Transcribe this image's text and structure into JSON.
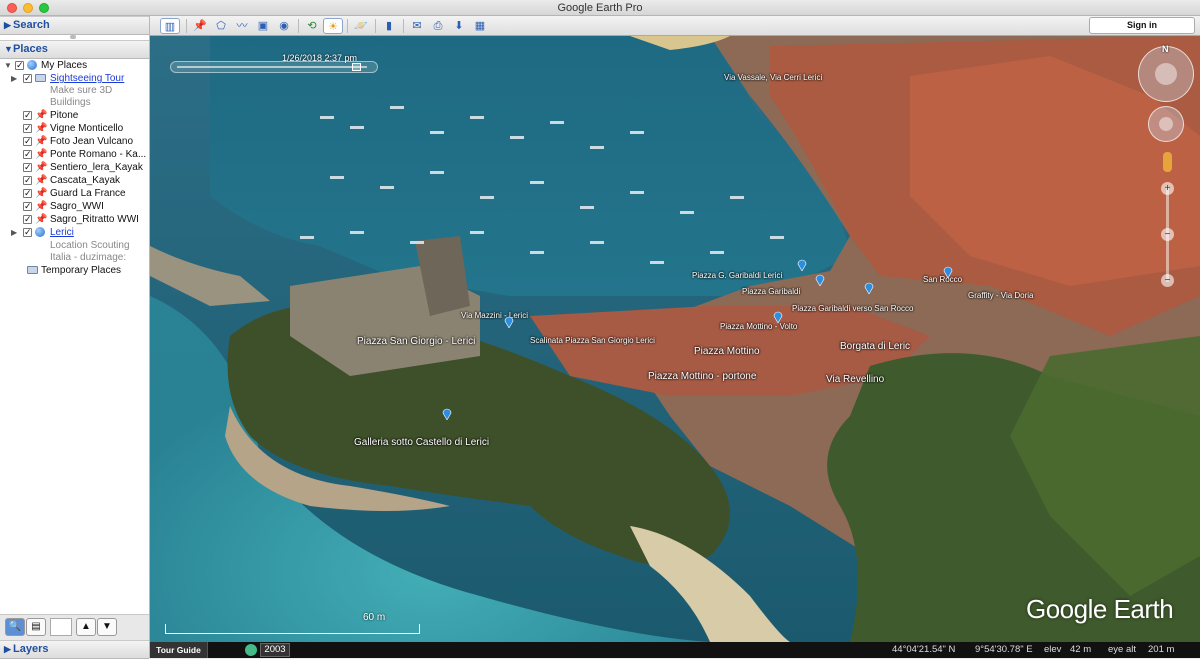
{
  "window": {
    "title": "Google Earth Pro"
  },
  "sidebar": {
    "search_label": "Search",
    "places_label": "Places",
    "layers_label": "Layers",
    "tree": [
      {
        "label": "My Places",
        "kind": "globe",
        "checked": true,
        "link": false
      },
      {
        "label": "Sightseeing Tour",
        "kind": "folder",
        "checked": true,
        "link": true
      },
      {
        "label": "Make sure 3D",
        "kind": "desc"
      },
      {
        "label": "Buildings",
        "kind": "desc"
      },
      {
        "label": "Pitone",
        "kind": "pin",
        "checked": true
      },
      {
        "label": "Vigne Monticello",
        "kind": "pin",
        "checked": true
      },
      {
        "label": "Foto Jean Vulcano",
        "kind": "pin",
        "checked": true
      },
      {
        "label": "Ponte Romano - Ka...",
        "kind": "pin",
        "checked": true
      },
      {
        "label": "Sentiero_lera_Kayak",
        "kind": "pin",
        "checked": true
      },
      {
        "label": "Cascata_Kayak",
        "kind": "pin",
        "checked": true
      },
      {
        "label": "Guard La France",
        "kind": "pin",
        "checked": true
      },
      {
        "label": "Sagro_WWI",
        "kind": "pin",
        "checked": true
      },
      {
        "label": "Sagro_Ritratto WWI",
        "kind": "pin",
        "checked": true
      },
      {
        "label": "Lerici",
        "kind": "globe",
        "checked": true,
        "link": true
      },
      {
        "label": "Location Scouting",
        "kind": "desc"
      },
      {
        "label": "Italia - duzimage:",
        "kind": "desc"
      },
      {
        "label": "Temporary Places",
        "kind": "folder-plain"
      }
    ]
  },
  "toolbar": {
    "signin_label": "Sign in"
  },
  "map": {
    "timestamp": "1/26/2018   2:37 pm",
    "scale_label": "60 m",
    "logo": "Google Earth",
    "nav_north": "N",
    "labels": {
      "via_mazzini": "Via Mazzini - Lerici",
      "piazza_san_giorgio": "Piazza San Giorgio - Lerici",
      "scalinata": "Scalinata Piazza San Giorgio Lerici",
      "piazza_garibaldi_lerici": "Piazza G. Garibaldi Lerici",
      "piazza_garibaldi": "Piazza Garibaldi",
      "piazza_garibaldi_rocco": "Piazza Garibaldi verso San Rocco",
      "san_rocco": "San Rocco",
      "graffity": "Graffity - Via Doria",
      "piazza_mottino_volto": "Piazza Mottino - Volto",
      "piazza_mottino": "Piazza Mottino",
      "borgata": "Borgata di Leric",
      "piazza_mottino_portone": "Piazza Mottino - portone",
      "via_revellino": "Via Revellino",
      "galleria": "Galleria sotto Castello di Lerici",
      "top_road": "Via Vassale, Via Cerri Lerici"
    }
  },
  "status": {
    "tour_guide": "Tour Guide",
    "year": "2003",
    "lat": "44°04'21.54\" N",
    "lon": "9°54'30.78\" E",
    "elev_label": "elev",
    "elev_value": "42 m",
    "eye_alt_label": "eye alt",
    "eye_alt_value": "201 m"
  },
  "colors": {
    "accent": "#1f4f9e",
    "link": "#1a3bd6",
    "sea": "#235f74",
    "roofs": "#b8553c"
  }
}
